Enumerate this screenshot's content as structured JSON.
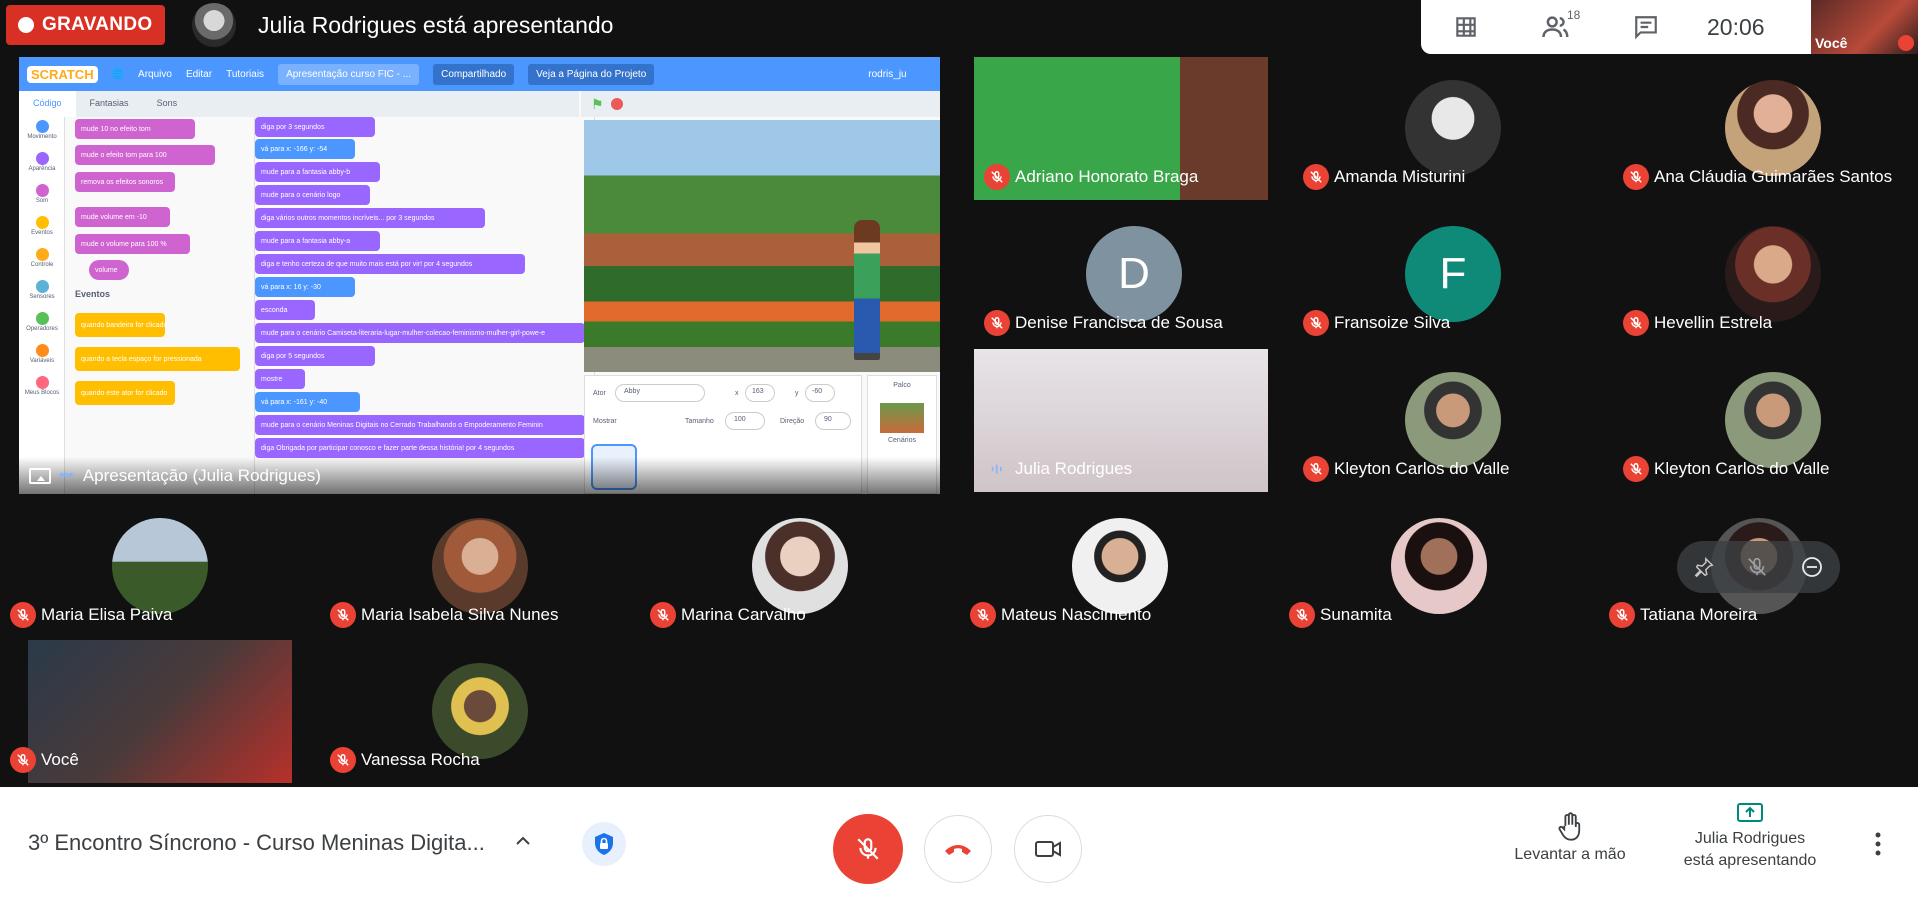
{
  "recording": {
    "label": "GRAVANDO"
  },
  "presenter_banner": {
    "title": "Julia Rodrigues está apresentando"
  },
  "top_panel": {
    "participants_count": "18",
    "clock": "20:06",
    "self_label": "Você"
  },
  "presentation": {
    "label": "Apresentação (Julia Rodrigues)",
    "scratch": {
      "menu": [
        "Arquivo",
        "Editar",
        "Tutoriais",
        "Apresentação curso FIC - ...",
        "Compartilhado",
        "Veja a Página do Projeto",
        "rodris_ju"
      ],
      "tabs": [
        "Código",
        "Fantasias",
        "Sons"
      ],
      "categories": [
        "Movimento",
        "Aparência",
        "Som",
        "Eventos",
        "Controle",
        "Sensores",
        "Operadores",
        "Variáveis",
        "Meus Blocos"
      ],
      "palette_heading": "Eventos",
      "sprite_name": "Abby",
      "sprite_x": "163",
      "sprite_y": "-60",
      "sprite_size": "100",
      "sprite_direction": "90",
      "labels": {
        "ator": "Ator",
        "x": "x",
        "y": "y",
        "mostrar": "Mostrar",
        "tamanho": "Tamanho",
        "direcao": "Direção",
        "palco": "Palco",
        "cenarios": "Cenários"
      },
      "palette_blocks": [
        "mude 10 no efeito tom",
        "mude o efeito tom para 100",
        "remova os efeitos sonoros",
        "mude volume em -10",
        "mude o volume para 100 %",
        "volume",
        "quando bandeira for clicado",
        "quando a tecla espaço for pressionada",
        "quando este ator for clicado"
      ],
      "script_blocks": [
        "diga por 3 segundos",
        "vá para x: -166 y: -54",
        "mude para a fantasia abby-b",
        "mude para o cenário logo",
        "diga vários outros momentos incríveis... por 3 segundos",
        "mude para a fantasia abby-a",
        "diga e tenho certeza de que muito mais está por vir! por 4 segundos",
        "vá para x: 16 y: -30",
        "esconda",
        "mude para o cenário Camiseta-literaria-lugar-mulher-colecao-feminismo-mulher-girl-powe-e",
        "diga por 5 segundos",
        "mostre",
        "vá para x: -161 y: -40",
        "mude para o cenário Meninas Digitais no Cerrado Trabalhando o Empoderamento Feminin",
        "diga Obrigada por participar conosco e fazer parte dessa história! por 4 segundos"
      ]
    }
  },
  "participants": [
    {
      "name": "Adriano Honorato Braga",
      "muted": true,
      "kind": "video"
    },
    {
      "name": "Amanda Misturini",
      "muted": true,
      "kind": "photo"
    },
    {
      "name": "Ana Cláudia Guimarães Santos",
      "muted": true,
      "kind": "photo"
    },
    {
      "name": "Denise Francisca de Sousa",
      "muted": true,
      "kind": "letter",
      "letter": "D",
      "color": "#7e929f"
    },
    {
      "name": "Fransoize Silva",
      "muted": true,
      "kind": "letter",
      "letter": "F",
      "color": "#0f8a79"
    },
    {
      "name": "Hevellin Estrela",
      "muted": true,
      "kind": "photo"
    },
    {
      "name": "Julia Rodrigues",
      "muted": false,
      "kind": "video"
    },
    {
      "name": "Kleyton Carlos do Valle",
      "muted": true,
      "kind": "photo"
    },
    {
      "name": "Kleyton Carlos do Valle",
      "muted": true,
      "kind": "photo"
    },
    {
      "name": "Maria Elisa Paiva",
      "muted": true,
      "kind": "photo"
    },
    {
      "name": "Maria Isabela Silva Nunes",
      "muted": true,
      "kind": "photo"
    },
    {
      "name": "Marina Carvalho",
      "muted": true,
      "kind": "photo"
    },
    {
      "name": "Mateus Nascimento",
      "muted": true,
      "kind": "photo"
    },
    {
      "name": "Sunamita",
      "muted": true,
      "kind": "photo"
    },
    {
      "name": "Tatiana Moreira",
      "muted": true,
      "kind": "photo"
    },
    {
      "name": "Você",
      "muted": true,
      "kind": "video"
    },
    {
      "name": "Vanessa Rocha",
      "muted": true,
      "kind": "photo"
    }
  ],
  "bottom": {
    "meeting_title": "3º Encontro Síncrono - Curso Meninas Digita...",
    "raise_hand": "Levantar a mão",
    "presenting_line1": "Julia Rodrigues",
    "presenting_line2": "está apresentando"
  },
  "colors": {
    "red": "#ea4335",
    "record_red": "#d93025",
    "scratch_blue": "#4c97ff"
  }
}
